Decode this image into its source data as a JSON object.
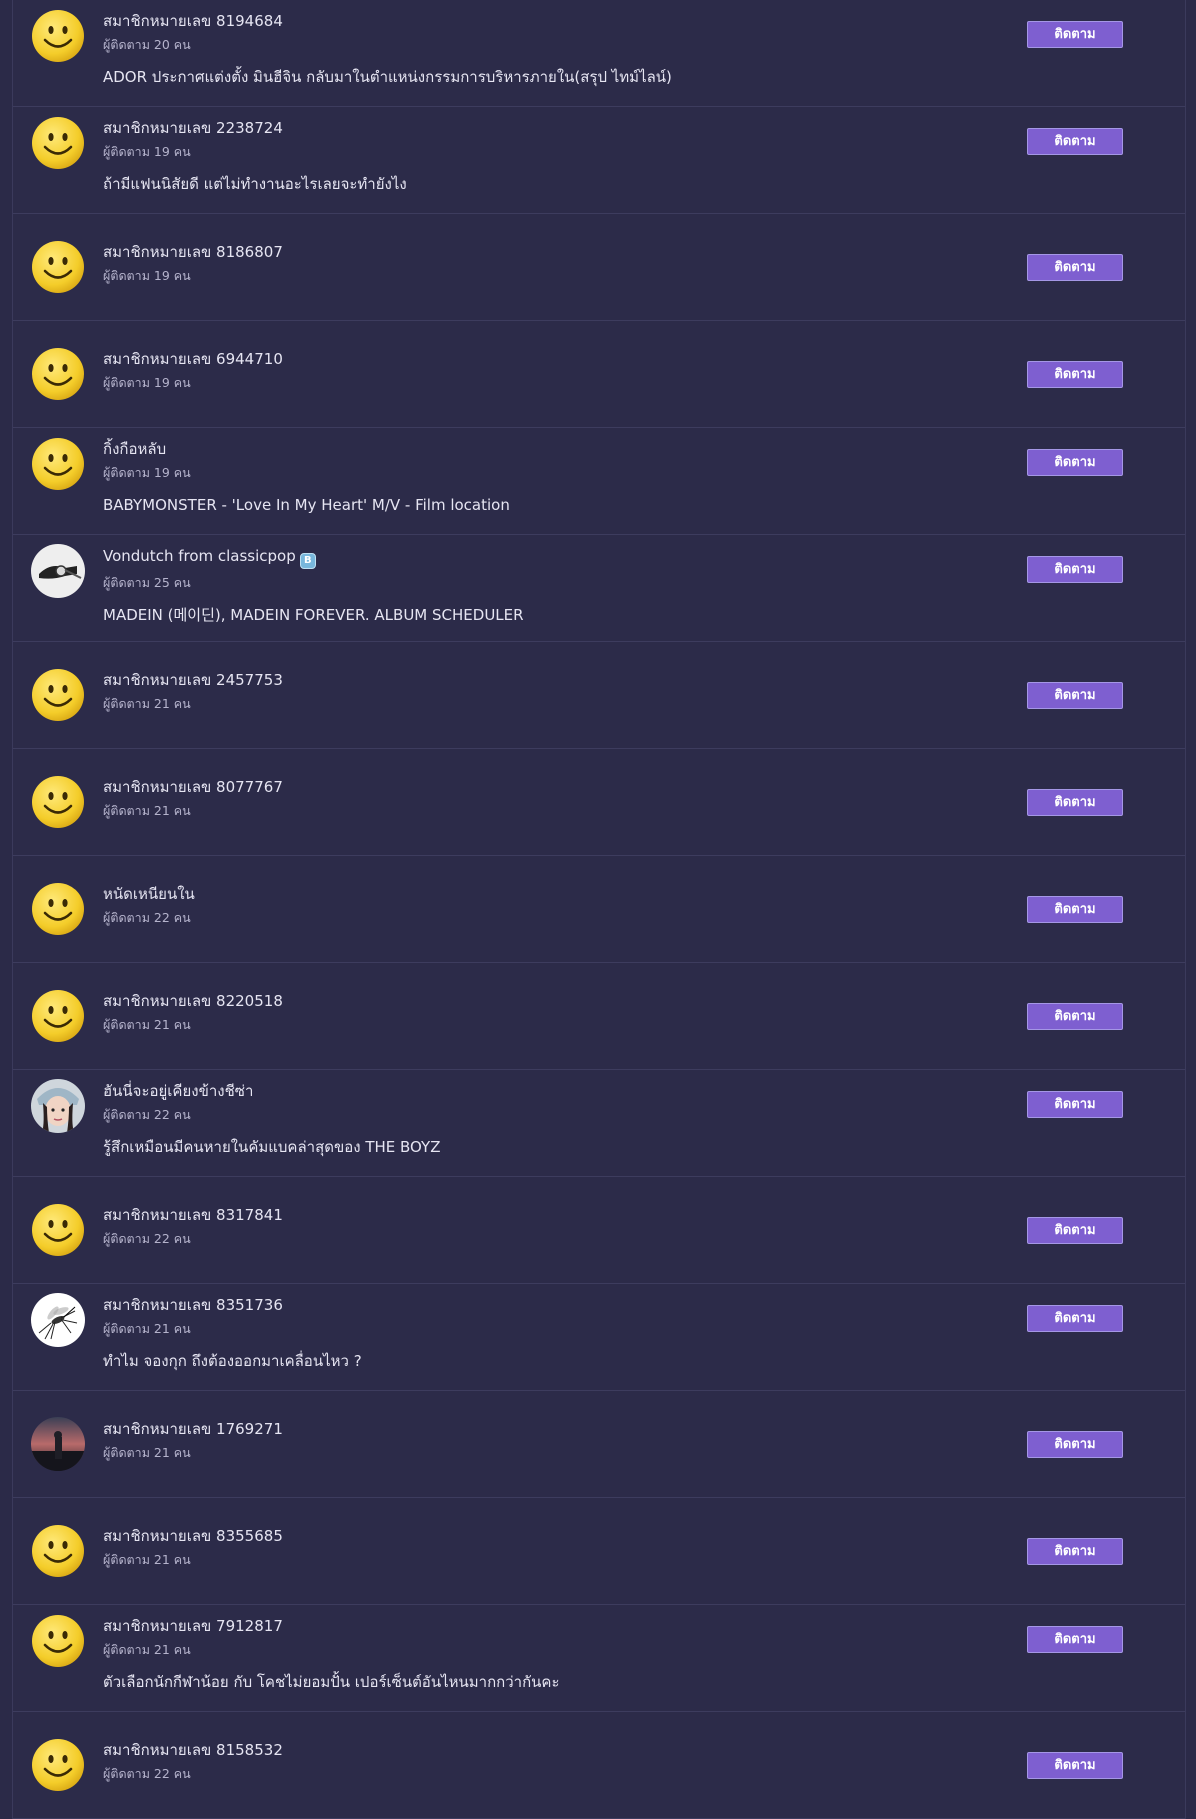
{
  "follow_label": "ติดตาม",
  "badge_letter": "B",
  "users": [
    {
      "name": "สมาชิกหมายเลข 8194684",
      "followers": "ผู้ติดตาม 20 คน",
      "topic": "ADOR ประกาศแต่งตั้ง มินฮีจิน กลับมาในตำแหน่งกรรมการบริหารภายใน(สรุป ไทม์ไลน์)",
      "avatar": "smiley-icon"
    },
    {
      "name": "สมาชิกหมายเลข 2238724",
      "followers": "ผู้ติดตาม 19 คน",
      "topic": "ถ้ามีแฟนนิสัยดี แต่ไม่ทำงานอะไรเลยจะทำยังไง",
      "avatar": "smiley-icon"
    },
    {
      "name": "สมาชิกหมายเลข 8186807",
      "followers": "ผู้ติดตาม 19 คน",
      "topic": "",
      "avatar": "smiley-icon"
    },
    {
      "name": "สมาชิกหมายเลข 6944710",
      "followers": "ผู้ติดตาม 19 คน",
      "topic": "",
      "avatar": "smiley-icon"
    },
    {
      "name": "กิ้งกือหลับ",
      "followers": "ผู้ติดตาม 19 คน",
      "topic": "BABYMONSTER - 'Love In My Heart' M/V - Film location",
      "avatar": "smiley-icon"
    },
    {
      "name": "Vondutch from classicpop",
      "followers": "ผู้ติดตาม 25 คน",
      "topic": "MADEIN (메이딘), MADEIN FOREVER. ALBUM SCHEDULER",
      "avatar": "hand-photo",
      "badge": true
    },
    {
      "name": "สมาชิกหมายเลข 2457753",
      "followers": "ผู้ติดตาม 21 คน",
      "topic": "",
      "avatar": "smiley-icon"
    },
    {
      "name": "สมาชิกหมายเลข 8077767",
      "followers": "ผู้ติดตาม 21 คน",
      "topic": "",
      "avatar": "smiley-icon"
    },
    {
      "name": "หนัดเหนียนใน",
      "followers": "ผู้ติดตาม 22 คน",
      "topic": "",
      "avatar": "smiley-icon"
    },
    {
      "name": "สมาชิกหมายเลข 8220518",
      "followers": "ผู้ติดตาม 21 คน",
      "topic": "",
      "avatar": "smiley-icon"
    },
    {
      "name": "ฮันนี่จะอยู่เคียงข้างชีซ่า",
      "followers": "ผู้ติดตาม 22 คน",
      "topic": "รู้สึกเหมือนมีคนหายในคัมแบคล่าสุดของ THE BOYZ",
      "avatar": "girl-photo"
    },
    {
      "name": "สมาชิกหมายเลข 8317841",
      "followers": "ผู้ติดตาม 22 คน",
      "topic": "",
      "avatar": "smiley-icon"
    },
    {
      "name": "สมาชิกหมายเลข 8351736",
      "followers": "ผู้ติดตาม 21 คน",
      "topic": "ทำไม จองกุก ถึงต้องออกมาเคลื่อนไหว ?",
      "avatar": "mosquito-photo"
    },
    {
      "name": "สมาชิกหมายเลข 1769271",
      "followers": "ผู้ติดตาม 21 คน",
      "topic": "",
      "avatar": "sunset-photo"
    },
    {
      "name": "สมาชิกหมายเลข 8355685",
      "followers": "ผู้ติดตาม 21 คน",
      "topic": "",
      "avatar": "smiley-icon"
    },
    {
      "name": "สมาชิกหมายเลข 7912817",
      "followers": "ผู้ติดตาม 21 คน",
      "topic": "ตัวเลือกนักกีฬาน้อย กับ โคชไม่ยอมปั้น เปอร์เซ็นต์อันไหนมากกว่ากันคะ",
      "avatar": "smiley-icon"
    },
    {
      "name": "สมาชิกหมายเลข 8158532",
      "followers": "ผู้ติดตาม 22 คน",
      "topic": "",
      "avatar": "smiley-icon"
    }
  ]
}
